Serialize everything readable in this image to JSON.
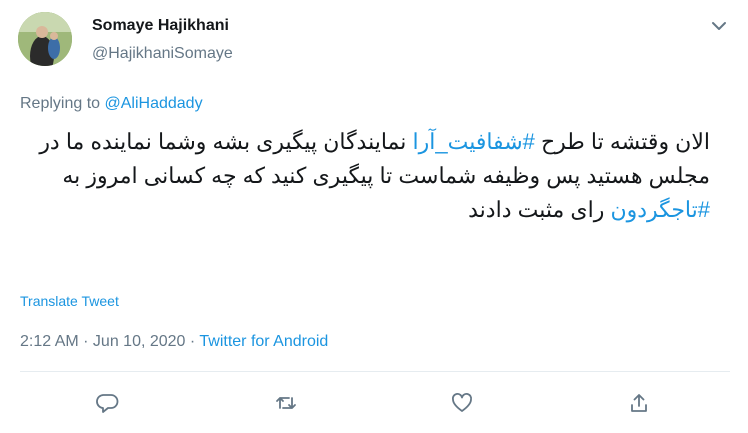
{
  "author": {
    "name": "Somaye Hajikhani",
    "handle": "@HajikhaniSomaye"
  },
  "reply": {
    "prefix": "Replying to ",
    "handle": "@AliHaddady"
  },
  "tweet": {
    "part1": "الان وقتشه تا طرح ",
    "hashtag1": "#شفافیت_آرا",
    "part2": "  نمایندگان پیگیری بشه وشما نماینده ما در مجلس هستید پس وظیفه شماست تا پیگیری کنید که چه کسانی امروز  به ",
    "hashtag2": "#تاجگردون",
    "part3": " رای مثبت دادند"
  },
  "translate_label": "Translate Tweet",
  "meta": {
    "time_date": "2:12 AM · Jun 10, 2020 · ",
    "source": "Twitter for Android"
  },
  "icons": {
    "reply": "reply-icon",
    "retweet": "retweet-icon",
    "like": "heart-icon",
    "share": "share-icon",
    "more": "chevron-down-icon"
  },
  "colors": {
    "link": "#1b95e0",
    "secondary_text": "#657786",
    "icon": "#657786"
  }
}
